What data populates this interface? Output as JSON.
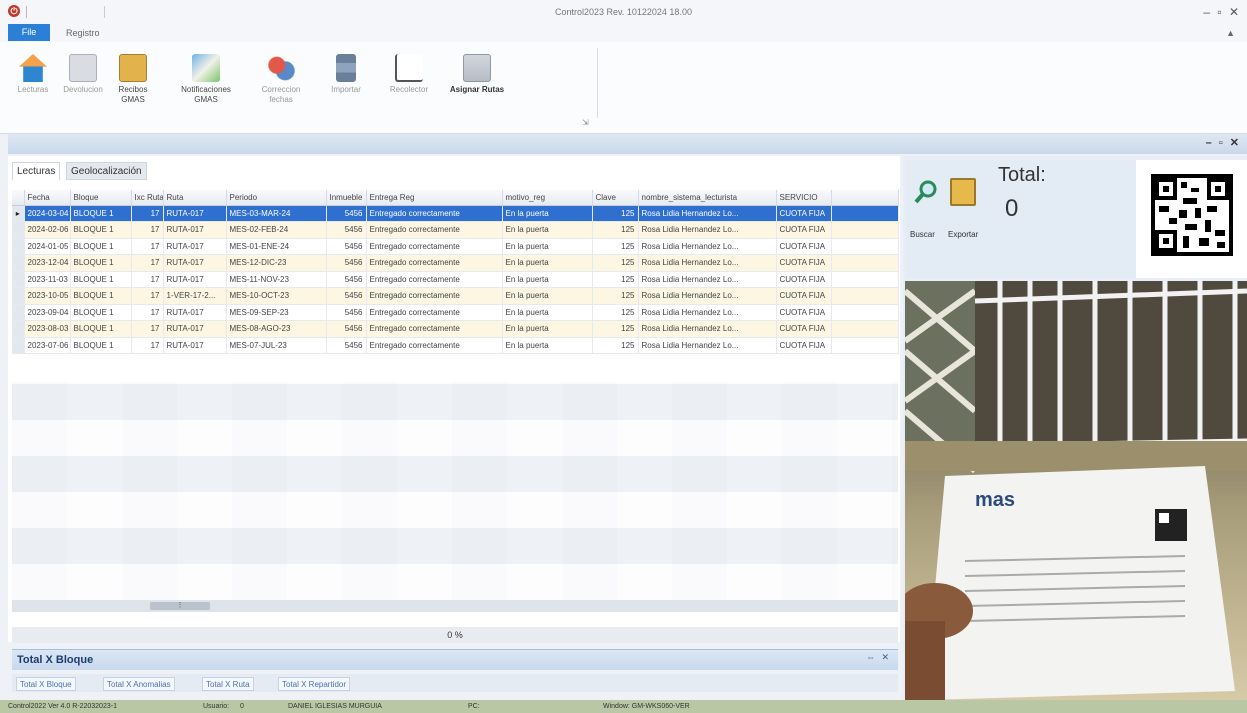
{
  "window": {
    "title": "Control2023 Rev. 10122024 18.00",
    "controls": "– ▫ ✕"
  },
  "menu": {
    "file": "File",
    "registro": "Registro"
  },
  "ribbon": {
    "buttons": [
      {
        "label": "Lecturas",
        "icon": "home-icon",
        "enabled": false
      },
      {
        "label": "Devolucion",
        "icon": "documents-icon",
        "enabled": false
      },
      {
        "label": "Recibos GMAS",
        "icon": "receipt-folder-icon",
        "enabled": true
      },
      {
        "label": "Notificaciones GMAS",
        "icon": "notification-icon",
        "enabled": true
      },
      {
        "label": "Correccion fechas",
        "icon": "gears-icon",
        "enabled": false
      },
      {
        "label": "Importar",
        "icon": "import-icon",
        "enabled": false
      },
      {
        "label": "Recolector",
        "icon": "chart-icon",
        "enabled": false
      },
      {
        "label": "Asignar Rutas",
        "icon": "assign-routes-icon",
        "enabled": true
      }
    ]
  },
  "tabs": [
    "Lecturas",
    "Geolocalización"
  ],
  "grid": {
    "columns": [
      "Fecha",
      "Bloque",
      "Ixc Ruta",
      "Ruta",
      "Periodo",
      "Inmueble",
      "Entrega Reg",
      "motivo_reg",
      "Clave",
      "nombre_sistema_lecturista",
      "SERVICIO"
    ],
    "rows": [
      [
        "2024-03-04",
        "BLOQUE 1",
        "17",
        "RUTA-017",
        "MES-03-MAR-24",
        "5456",
        "Entregado correctamente",
        "En la puerta",
        "125",
        "Rosa Lidia Hernandez Lo...",
        "CUOTA FIJA"
      ],
      [
        "2024-02-06",
        "BLOQUE 1",
        "17",
        "RUTA-017",
        "MES-02-FEB-24",
        "5456",
        "Entregado correctamente",
        "En la puerta",
        "125",
        "Rosa Lidia Hernandez Lo...",
        "CUOTA FIJA"
      ],
      [
        "2024-01-05",
        "BLOQUE 1",
        "17",
        "RUTA-017",
        "MES-01-ENE-24",
        "5456",
        "Entregado correctamente",
        "En la puerta",
        "125",
        "Rosa Lidia Hernandez Lo...",
        "CUOTA FIJA"
      ],
      [
        "2023-12-04",
        "BLOQUE 1",
        "17",
        "RUTA-017",
        "MES-12-DIC-23",
        "5456",
        "Entregado correctamente",
        "En la puerta",
        "125",
        "Rosa Lidia Hernandez Lo...",
        "CUOTA FIJA"
      ],
      [
        "2023-11-03",
        "BLOQUE 1",
        "17",
        "RUTA-017",
        "MES-11-NOV-23",
        "5456",
        "Entregado correctamente",
        "En la puerta",
        "125",
        "Rosa Lidia Hernandez Lo...",
        "CUOTA FIJA"
      ],
      [
        "2023-10-05",
        "BLOQUE 1",
        "17",
        "1-VER-17-2...",
        "MES-10-OCT-23",
        "5456",
        "Entregado correctamente",
        "En la puerta",
        "125",
        "Rosa Lidia Hernandez Lo...",
        "CUOTA FIJA"
      ],
      [
        "2023-09-04",
        "BLOQUE 1",
        "17",
        "RUTA-017",
        "MES-09-SEP-23",
        "5456",
        "Entregado correctamente",
        "En la puerta",
        "125",
        "Rosa Lidia Hernandez Lo...",
        "CUOTA FIJA"
      ],
      [
        "2023-08-03",
        "BLOQUE 1",
        "17",
        "RUTA-017",
        "MES-08-AGO-23",
        "5456",
        "Entregado correctamente",
        "En la puerta",
        "125",
        "Rosa Lidia Hernandez Lo...",
        "CUOTA FIJA"
      ],
      [
        "2023-07-06",
        "BLOQUE 1",
        "17",
        "RUTA-017",
        "MES-07-JUL-23",
        "5456",
        "Entregado correctamente",
        "En la puerta",
        "125",
        "Rosa Lidia Hernandez Lo...",
        "CUOTA FIJA"
      ]
    ],
    "selected_row": 0
  },
  "progress": "0 %",
  "panel": {
    "title": "Total X Bloque",
    "controls": "⇔ ✕",
    "tabs": [
      "Total X Bloque",
      "Total X Anomalias",
      "Total X Ruta",
      "Total X Repartidor"
    ]
  },
  "right": {
    "buscar": "Buscar",
    "exportar": "Exportar",
    "total_label": "Total:",
    "total_value": "0"
  },
  "statusbar": {
    "version": "Control2022 Ver 4.0 R-22032023-1",
    "usuario_label": "Usuario:",
    "usuario_id": "0",
    "usuario_name": "DANIEL IGLESIAS MURGUIA",
    "pc_label": "PC:",
    "window": "Window: GM-WKS060-VER"
  },
  "colors": {
    "accent": "#2b7fd6",
    "selected_row": "#2f6fd0",
    "statusbar": "#b9c7a4"
  }
}
